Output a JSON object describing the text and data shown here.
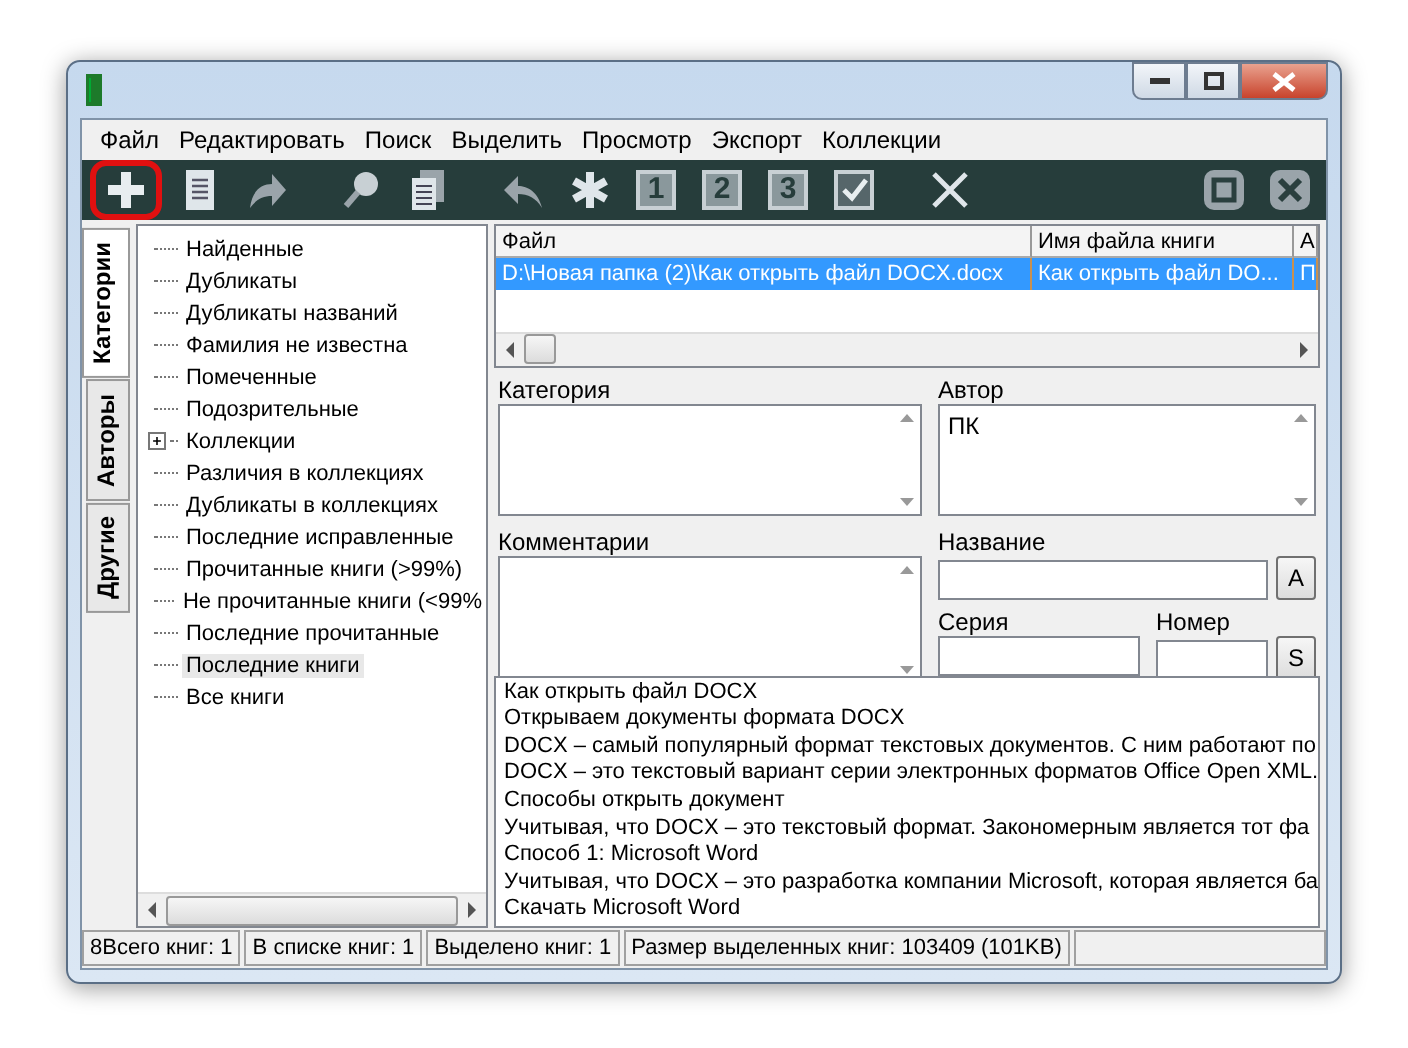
{
  "menu": [
    "Файл",
    "Редактировать",
    "Поиск",
    "Выделить",
    "Просмотр",
    "Экспорт",
    "Коллекции"
  ],
  "toolbar": [
    {
      "kind": "plus",
      "highlighted": true
    },
    {
      "kind": "document",
      "highlighted": false
    },
    {
      "kind": "redo",
      "highlighted": false
    },
    {
      "kind": "gap"
    },
    {
      "kind": "search",
      "highlighted": false
    },
    {
      "kind": "pages",
      "highlighted": false
    },
    {
      "kind": "gap"
    },
    {
      "kind": "undo",
      "highlighted": false
    },
    {
      "kind": "asterisk",
      "highlighted": false
    },
    {
      "kind": "number",
      "label": "1",
      "highlighted": false
    },
    {
      "kind": "number",
      "label": "2",
      "highlighted": false
    },
    {
      "kind": "number",
      "label": "3",
      "highlighted": false
    },
    {
      "kind": "check",
      "highlighted": false
    },
    {
      "kind": "gap"
    },
    {
      "kind": "cross",
      "highlighted": false
    },
    {
      "kind": "spacer"
    },
    {
      "kind": "restore",
      "highlighted": false
    },
    {
      "kind": "close",
      "highlighted": false
    }
  ],
  "side_tabs": [
    {
      "label": "Категории",
      "selected": true
    },
    {
      "label": "Авторы",
      "selected": false
    },
    {
      "label": "Другие",
      "selected": false
    }
  ],
  "tree": [
    {
      "label": "Найденные",
      "selected": false
    },
    {
      "label": "Дубликаты",
      "selected": false
    },
    {
      "label": "Дубликаты названий",
      "selected": false
    },
    {
      "label": "Фамилия не известна",
      "selected": false
    },
    {
      "label": "Помеченные",
      "selected": false
    },
    {
      "label": "Подозрительные",
      "selected": false
    },
    {
      "label": "Коллекции",
      "selected": false,
      "expanded": false
    },
    {
      "label": "Различия в коллекциях",
      "selected": false
    },
    {
      "label": "Дубликаты в коллекциях",
      "selected": false
    },
    {
      "label": "Последние исправленные",
      "selected": false
    },
    {
      "label": "Прочитанные книги (>99%)",
      "selected": false
    },
    {
      "label": "Не прочитанные книги (<99%",
      "selected": false
    },
    {
      "label": "Последние прочитанные",
      "selected": false
    },
    {
      "label": "Последние книги",
      "selected": true
    },
    {
      "label": "Все книги",
      "selected": false
    }
  ],
  "table": {
    "columns": [
      "Файл",
      "Имя файла книги",
      "А"
    ],
    "rows": [
      {
        "cells": [
          "D:\\Новая папка (2)\\Как открыть файл DOCX.docx",
          "Как открыть файл DO...",
          "П"
        ],
        "selected": true
      }
    ]
  },
  "fields": {
    "category": {
      "label": "Категория"
    },
    "author": {
      "label": "Автор",
      "value": "ПК"
    },
    "comments": {
      "label": "Комментарии"
    },
    "title": {
      "label": "Название",
      "button": "A"
    },
    "series": {
      "label": "Серия"
    },
    "number": {
      "label": "Номер",
      "button": "S"
    }
  },
  "preview": [
    "Как открыть файл DOCX",
    "Открываем документы формата DOCX",
    "DOCX – самый популярный формат текстовых документов. С ним работают по",
    "DOCX – это текстовый вариант серии электронных форматов Office Open XML.",
    "Способы открыть документ",
    "Учитывая, что DOCX – это текстовый формат. Закономерным является тот фа",
    "Способ 1: Microsoft Word",
    "Учитывая, что DOCX – это разработка компании Microsoft, которая является ба",
    "Скачать Microsoft Word"
  ],
  "status_bar": [
    "8Всего книг: 1",
    "В списке книг: 1",
    "Выделено книг: 1",
    "Размер выделенных книг: 103409  (101KB)"
  ]
}
